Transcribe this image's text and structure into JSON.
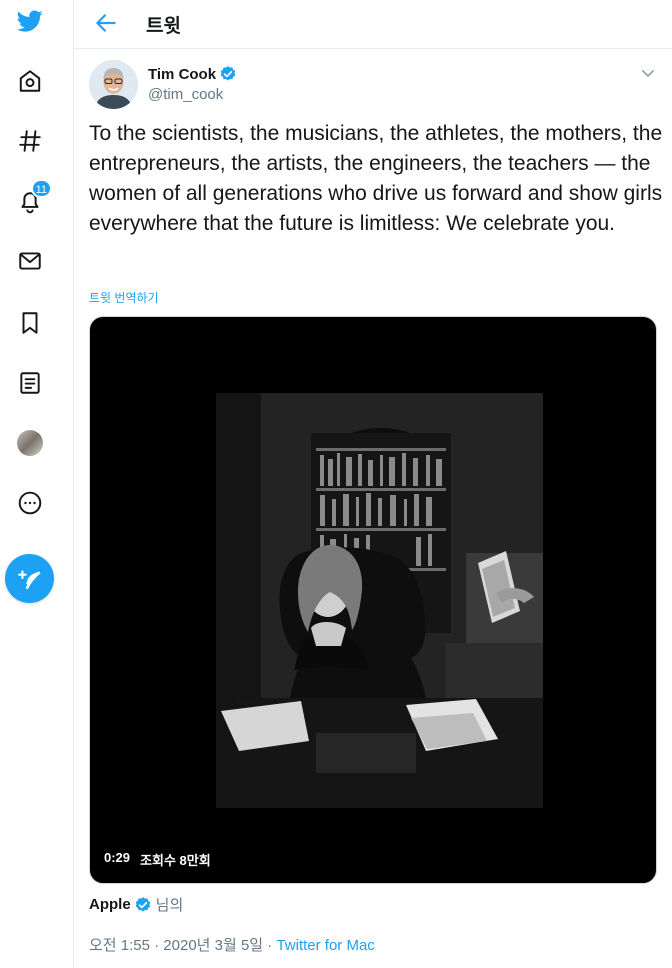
{
  "header": {
    "title": "트윗"
  },
  "nav": {
    "notifications_count": "11"
  },
  "tweet": {
    "author_name": "Tim Cook",
    "author_handle": "@tim_cook",
    "text": "To the scientists, the musicians, the athletes, the mothers, the entrepreneurs, the artists, the engineers, the teachers — the women of all generations who drive us forward and show girls everywhere that the future is limitless: We celebrate you.",
    "translate_label": "트윗 번역하기",
    "video": {
      "duration": "0:29",
      "views": "조회수 8만회"
    },
    "attribution": {
      "name": "Apple",
      "suffix": "님의"
    },
    "timestamp": "오전 1:55 · 2020년 3월 5일",
    "separator": " · ",
    "source": "Twitter for Mac"
  },
  "colors": {
    "accent": "#1da1f2",
    "secondary_text": "#657786",
    "primary_text": "#14171a"
  }
}
